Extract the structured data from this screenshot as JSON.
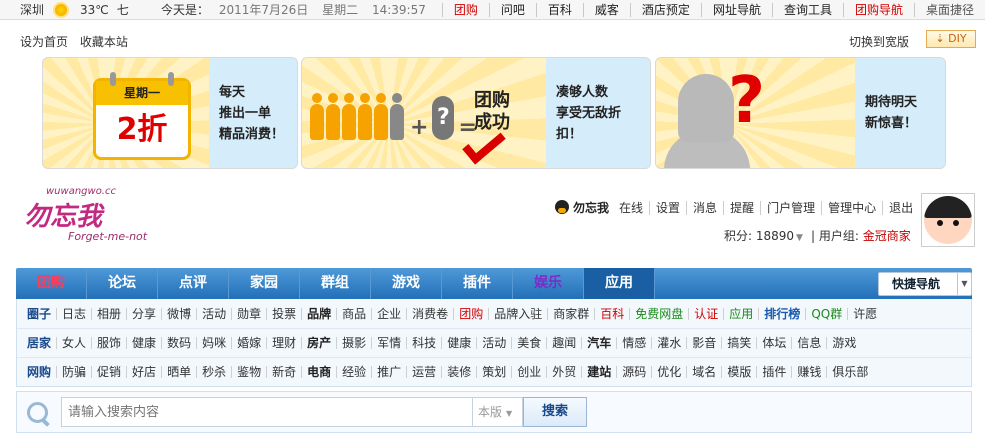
{
  "topbar": {
    "city": "深圳",
    "weather_icon": "sun-icon",
    "temp": "33℃",
    "weekday_short": "七",
    "today_label": "今天是：",
    "date": "2011年7月26日",
    "weekday": "星期二",
    "time": "14:39:57",
    "links": [
      {
        "label": "团购",
        "style": "red"
      },
      {
        "label": "问吧",
        "style": ""
      },
      {
        "label": "百科",
        "style": ""
      },
      {
        "label": "威客",
        "style": ""
      },
      {
        "label": "酒店预定",
        "style": ""
      },
      {
        "label": "网址导航",
        "style": ""
      },
      {
        "label": "查询工具",
        "style": ""
      },
      {
        "label": "团购导航",
        "style": "red"
      },
      {
        "label": "桌面捷径",
        "style": "gray"
      }
    ]
  },
  "line2": {
    "set_home": "设为首页",
    "bookmark": "收藏本站",
    "switch_wide": "切换到宽版",
    "diy": "DIY"
  },
  "banners": {
    "b1": {
      "cal_top": "星期一",
      "cal_big": "2折",
      "lines": [
        "每天",
        "推出一单",
        "精品消费！"
      ]
    },
    "b2": {
      "title_1": "团购",
      "title_2": "成功",
      "lines": [
        "凑够人数",
        "享受无敌折",
        "扣！"
      ]
    },
    "b3": {
      "qmark": "?",
      "lines": [
        "期待明天",
        "新惊喜！"
      ]
    }
  },
  "logo": {
    "top": "wuwangwo.cc",
    "main": "勿忘我",
    "sub": "Forget-me-not"
  },
  "user": {
    "name": "勿忘我",
    "links": [
      "在线",
      "设置",
      "消息",
      "提醒",
      "门户管理",
      "管理中心",
      "退出"
    ],
    "credits_label": "积分: 18890",
    "group_label": "用户组:",
    "group": "金冠商家"
  },
  "nav": {
    "tabs": [
      {
        "label": "团购",
        "style": "tg"
      },
      {
        "label": "论坛",
        "style": ""
      },
      {
        "label": "点评",
        "style": ""
      },
      {
        "label": "家园",
        "style": ""
      },
      {
        "label": "群组",
        "style": ""
      },
      {
        "label": "游戏",
        "style": ""
      },
      {
        "label": "插件",
        "style": ""
      },
      {
        "label": "娱乐",
        "style": "yl"
      },
      {
        "label": "应用",
        "style": "active"
      }
    ],
    "quick": "快捷导航"
  },
  "rows": [
    {
      "items": [
        {
          "t": "圈子",
          "c": "first"
        },
        {
          "t": "日志"
        },
        {
          "t": "相册"
        },
        {
          "t": "分享"
        },
        {
          "t": "微博"
        },
        {
          "t": "活动"
        },
        {
          "t": "勋章"
        },
        {
          "t": "投票"
        },
        {
          "t": "品牌",
          "c": "b"
        },
        {
          "t": "商品"
        },
        {
          "t": "企业"
        },
        {
          "t": "消费卷"
        },
        {
          "t": "团购",
          "c": "r"
        },
        {
          "t": "品牌入驻"
        },
        {
          "t": "商家群"
        },
        {
          "t": "百科",
          "c": "r"
        },
        {
          "t": "免费网盘",
          "c": "g"
        },
        {
          "t": "认证",
          "c": "r"
        },
        {
          "t": "应用",
          "c": "g"
        },
        {
          "t": "排行榜",
          "c": "bl"
        },
        {
          "t": "QQ群",
          "c": "g"
        },
        {
          "t": "许愿"
        }
      ]
    },
    {
      "items": [
        {
          "t": "居家",
          "c": "first"
        },
        {
          "t": "女人"
        },
        {
          "t": "服饰"
        },
        {
          "t": "健康"
        },
        {
          "t": "数码"
        },
        {
          "t": "妈咪"
        },
        {
          "t": "婚嫁"
        },
        {
          "t": "理财"
        },
        {
          "t": "房产",
          "c": "b"
        },
        {
          "t": "摄影"
        },
        {
          "t": "军情"
        },
        {
          "t": "科技"
        },
        {
          "t": "健康"
        },
        {
          "t": "活动"
        },
        {
          "t": "美食"
        },
        {
          "t": "趣闻"
        },
        {
          "t": "汽车",
          "c": "b"
        },
        {
          "t": "情感"
        },
        {
          "t": "灌水"
        },
        {
          "t": "影音"
        },
        {
          "t": "搞笑"
        },
        {
          "t": "体坛"
        },
        {
          "t": "信息"
        },
        {
          "t": "游戏"
        }
      ]
    },
    {
      "items": [
        {
          "t": "网购",
          "c": "first"
        },
        {
          "t": "防骗"
        },
        {
          "t": "促销"
        },
        {
          "t": "好店"
        },
        {
          "t": "晒单"
        },
        {
          "t": "秒杀"
        },
        {
          "t": "鉴物"
        },
        {
          "t": "新奇"
        },
        {
          "t": "电商",
          "c": "b"
        },
        {
          "t": "经验"
        },
        {
          "t": "推广"
        },
        {
          "t": "运营"
        },
        {
          "t": "装修"
        },
        {
          "t": "策划"
        },
        {
          "t": "创业"
        },
        {
          "t": "外贸"
        },
        {
          "t": "建站",
          "c": "b"
        },
        {
          "t": "源码"
        },
        {
          "t": "优化"
        },
        {
          "t": "域名"
        },
        {
          "t": "模版"
        },
        {
          "t": "插件"
        },
        {
          "t": "赚钱"
        },
        {
          "t": "俱乐部"
        }
      ]
    }
  ],
  "search": {
    "placeholder": "请输入搜索内容",
    "scope": "本版",
    "button": "搜索"
  }
}
